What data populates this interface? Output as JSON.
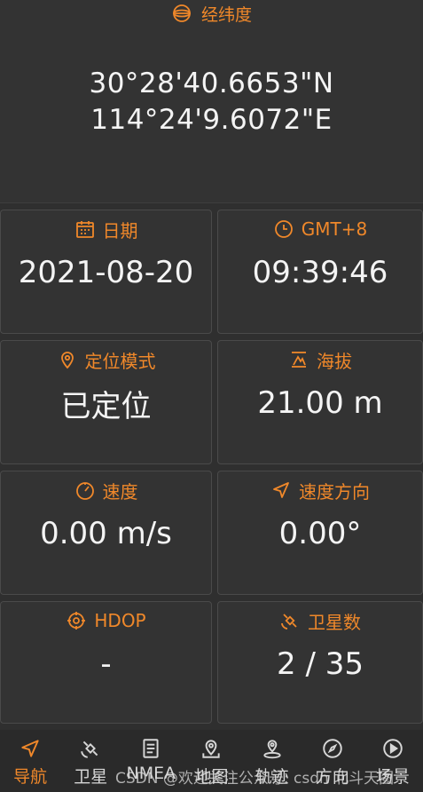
{
  "coordinates": {
    "header": "经纬度",
    "latitude": "30°28'40.6653\"N",
    "longitude": "114°24'9.6072\"E"
  },
  "cards": {
    "date": {
      "label": "日期",
      "value": "2021-08-20"
    },
    "time": {
      "label": "GMT+8",
      "value": "09:39:46"
    },
    "fix_mode": {
      "label": "定位模式",
      "value": "已定位"
    },
    "altitude": {
      "label": "海拔",
      "value": "21.00 m"
    },
    "speed": {
      "label": "速度",
      "value": "0.00 m/s"
    },
    "heading": {
      "label": "速度方向",
      "value": "0.00°"
    },
    "hdop": {
      "label": "HDOP",
      "value": "-"
    },
    "satellites": {
      "label": "卫星数",
      "value": "2 / 35"
    }
  },
  "nav": {
    "items": [
      {
        "label": "导航",
        "icon": "navigation-arrow-icon",
        "active": true
      },
      {
        "label": "卫星",
        "icon": "satellite-icon",
        "active": false
      },
      {
        "label": "NMEA",
        "icon": "document-icon",
        "active": false
      },
      {
        "label": "地图",
        "icon": "map-pin-icon",
        "active": false
      },
      {
        "label": "轨迹",
        "icon": "track-pin-icon",
        "active": false
      },
      {
        "label": "方向",
        "icon": "compass-icon",
        "active": false
      },
      {
        "label": "场景",
        "icon": "play-icon",
        "active": false
      }
    ]
  },
  "watermark": "CSDN @欢迎关注公众号: csdn 北斗天图",
  "colors": {
    "accent": "#f0882a",
    "background": "#2f2f2f",
    "card": "#333333",
    "text": "#f4f4f4"
  }
}
